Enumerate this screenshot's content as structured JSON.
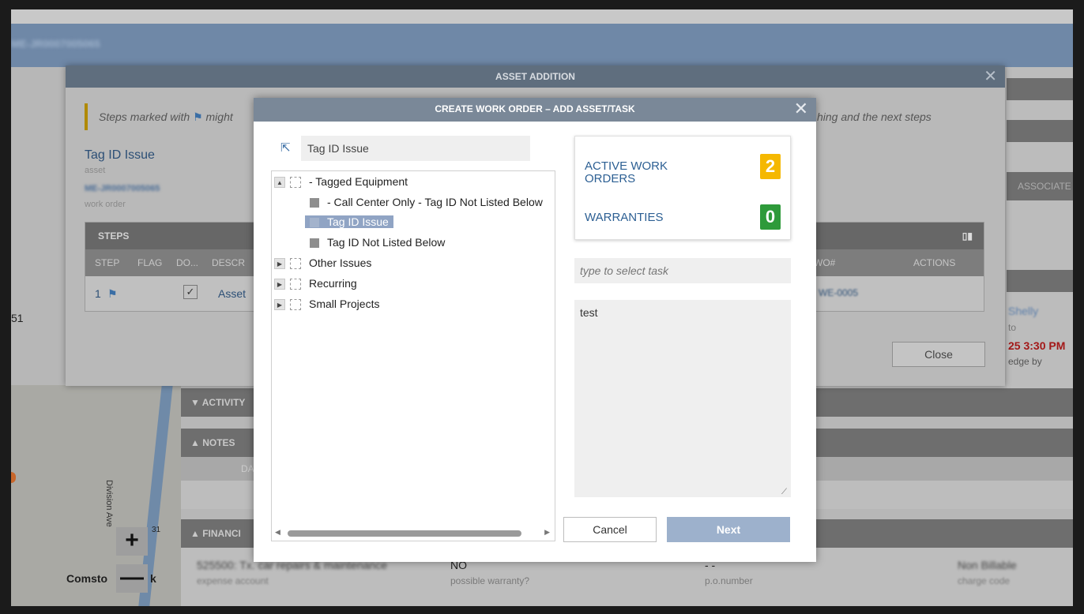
{
  "background": {
    "topbar_text": "ME-JR0007005065",
    "left_number": "51",
    "map": {
      "zoom_in": "+",
      "zoom_out": "—",
      "label": "Comsto",
      "label_k": "k",
      "road_label": "Division Ave",
      "route_num": "31"
    },
    "sections": {
      "activity": "▼  ACTIVITY",
      "notes": "▲  NOTES",
      "notes_col": "DA",
      "financial": "▲  FINANCI"
    },
    "financial": {
      "expense_value": "525500: Tx. car repairs & maintenance",
      "expense_label": "expense account",
      "warranty_value": "NO",
      "warranty_label": "possible warranty?",
      "po_value": "- -",
      "po_label": "p.o.number",
      "charge_value": "Non Billable",
      "charge_label": "charge code"
    },
    "right_strip": {
      "associate_col": "ASSOCIATE",
      "name": "Shelly",
      "to": "to",
      "time": "25 3:30 PM",
      "ack": "edge by"
    }
  },
  "asset_dialog": {
    "title": "ASSET ADDITION",
    "close_x": "✕",
    "warning_start": "Steps marked with",
    "warning_flag": "⚑",
    "warning_mid": "might",
    "warning_end": "hing and the next steps",
    "tag_link": "Tag ID Issue",
    "asset_label": "asset",
    "wo_number": "ME-JR0007005065",
    "wo_label": "work order",
    "steps": {
      "title": "STEPS",
      "cols": [
        "STEP",
        "FLAG",
        "DO...",
        "DESCR",
        "WO#",
        "ACTIONS"
      ],
      "row": {
        "step": "1",
        "flag": "⚑",
        "desc": "Asset",
        "wo": "WE-0005"
      }
    },
    "close_label": "Close"
  },
  "wo_modal": {
    "title": "CREATE WORK ORDER – ADD ASSET/TASK",
    "close_x": "✕",
    "path_icon": "⇱",
    "path_value": "Tag ID Issue",
    "tree": {
      "root": "- Tagged Equipment",
      "children": [
        "- Call Center Only - Tag ID Not Listed Below",
        "Tag ID Issue",
        "Tag ID Not Listed Below"
      ],
      "others": [
        "Other Issues",
        "Recurring",
        "Small Projects"
      ]
    },
    "stats": {
      "active_label": "ACTIVE WORK ORDERS",
      "active_count": "2",
      "active_color": "#f5b800",
      "warranties_label": "WARRANTIES",
      "warranties_count": "0",
      "warranties_color": "#2e9a3a"
    },
    "task_placeholder": "type to select task",
    "notes_value": "test",
    "cancel_label": "Cancel",
    "next_label": "Next"
  }
}
